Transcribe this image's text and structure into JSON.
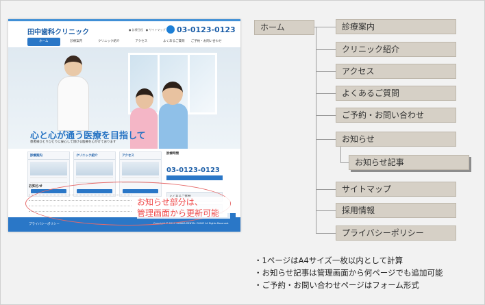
{
  "site": {
    "logo": "田中歯科クリニック",
    "small_links": "● 診療日程　● サイトマップ",
    "tel": "03-0123-0123",
    "nav": [
      "ホーム",
      "診療案内",
      "クリニック紹介",
      "アクセス",
      "よくあるご質問",
      "ご予約・お問い合わせ"
    ],
    "catch": "心と心が通う医療を目指して",
    "catch_sub": "患者様ひとりひとりに安心して頂ける医療を心がけております",
    "cards": [
      "診療案内",
      "クリニック紹介",
      "アクセス"
    ],
    "hours_title": "診療時間",
    "side_banner": "よくあるご質問",
    "news_title": "お知らせ",
    "footer_left": "プライバシーポリシー",
    "footer_right": "Copyright © 2013 TANAKA DENTAL CLINIC All Rights Reserved."
  },
  "note": [
    "お知らせ部分は、",
    "管理画面から更新可能"
  ],
  "sitemap": {
    "root": "ホーム",
    "items": [
      "診療案内",
      "クリニック紹介",
      "アクセス",
      "よくあるご質問",
      "ご予約・お問い合わせ",
      "お知らせ",
      "サイトマップ",
      "採用情報",
      "プライバシーポリシー"
    ],
    "child_of_news": "お知らせ記事"
  },
  "bullets": [
    "・1ページはA4サイズ一枚以内として計算",
    "・お知らせ記事は管理画面から何ページでも追加可能",
    "・ご予約・お問い合わせページはフォーム形式"
  ],
  "colors": {
    "accent": "#2a77c7",
    "node_fill": "#d6d0c6",
    "note_red": "#ef4a4a"
  }
}
